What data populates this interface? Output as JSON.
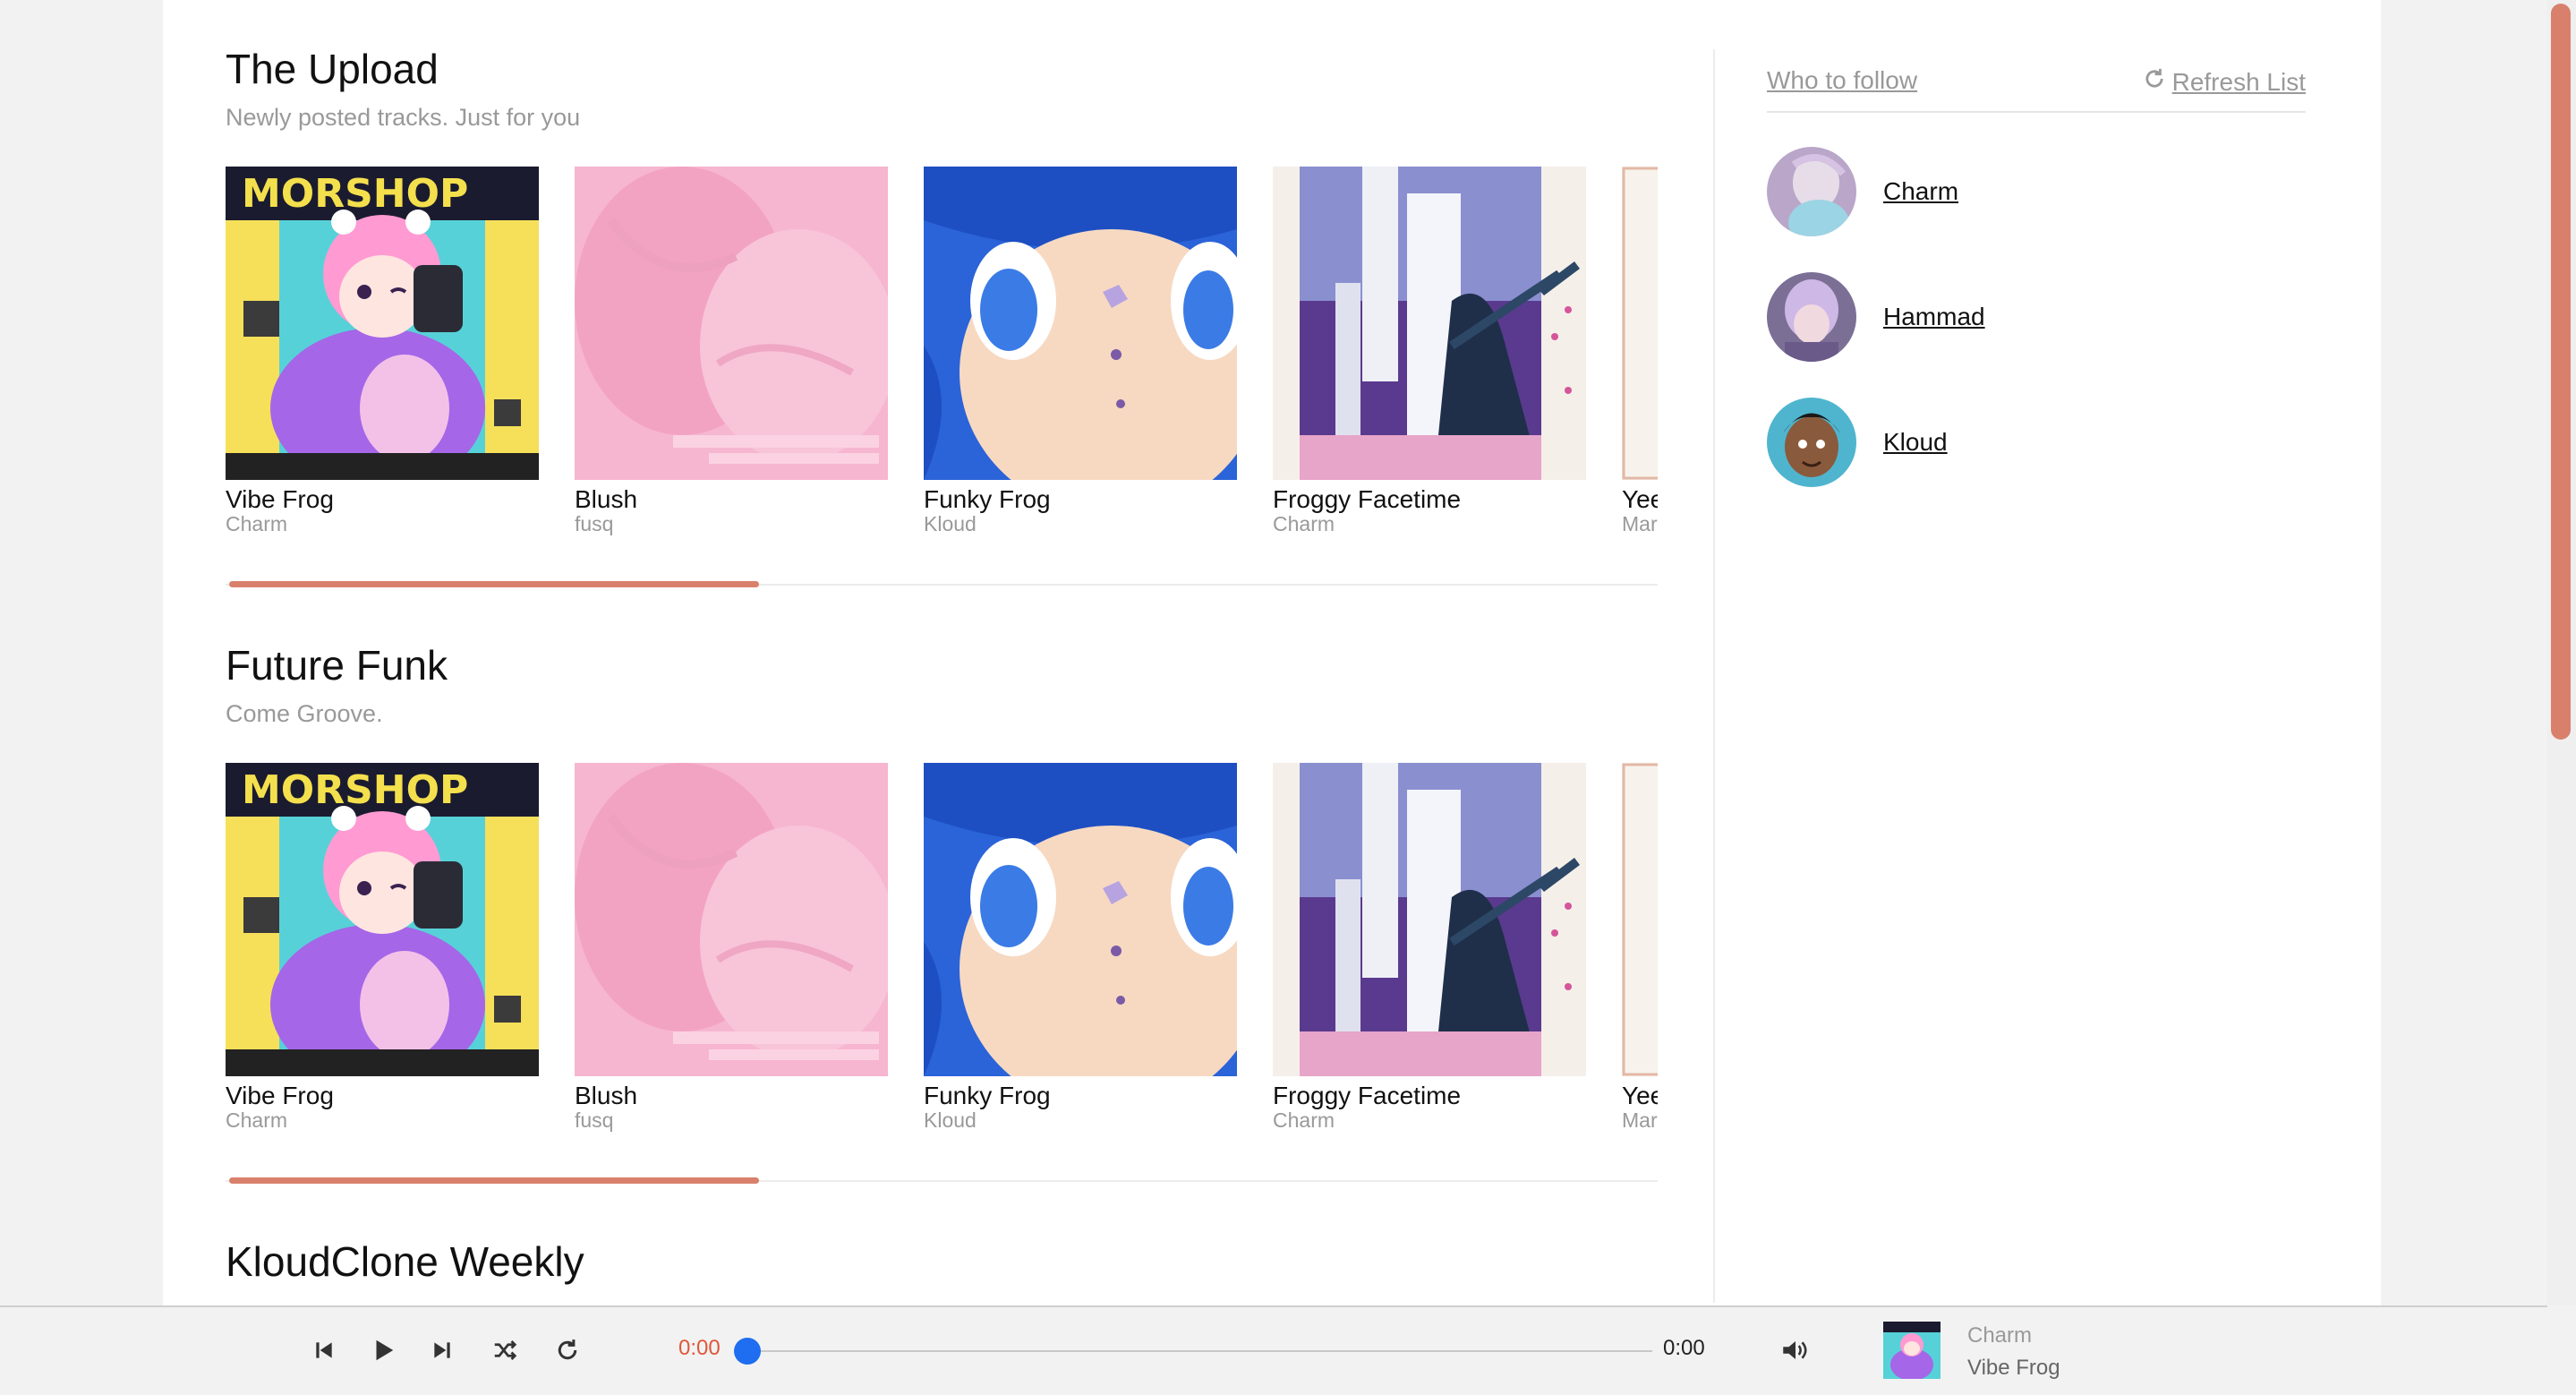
{
  "sections": [
    {
      "title": "The Upload",
      "subtitle": "Newly posted tracks. Just for you",
      "tracks": [
        {
          "title": "Vibe Frog",
          "artist": "Charm"
        },
        {
          "title": "Blush",
          "artist": "fusq"
        },
        {
          "title": "Funky Frog",
          "artist": "Kloud"
        },
        {
          "title": "Froggy Facetime",
          "artist": "Charm"
        },
        {
          "title": "Yee",
          "artist": "Mar"
        }
      ],
      "scroll_fraction": 0.37
    },
    {
      "title": "Future Funk",
      "subtitle": "Come Groove.",
      "tracks": [
        {
          "title": "Vibe Frog",
          "artist": "Charm"
        },
        {
          "title": "Blush",
          "artist": "fusq"
        },
        {
          "title": "Funky Frog",
          "artist": "Kloud"
        },
        {
          "title": "Froggy Facetime",
          "artist": "Charm"
        },
        {
          "title": "Yee",
          "artist": "Mar"
        }
      ],
      "scroll_fraction": 0.37
    },
    {
      "title": "KloudClone Weekly"
    }
  ],
  "sidebar": {
    "heading": "Who to follow",
    "refresh_label": "Refresh List",
    "users": [
      {
        "name": "Charm"
      },
      {
        "name": "Hammad"
      },
      {
        "name": "Kloud"
      }
    ]
  },
  "player": {
    "current_time": "0:00",
    "total_time": "0:00",
    "progress": 0,
    "now_playing": {
      "artist": "Charm",
      "title": "Vibe Frog"
    },
    "accent_color": "#d9806c",
    "knob_color": "#1f6df0"
  },
  "icons": [
    "skip-back-icon",
    "play-icon",
    "skip-forward-icon",
    "shuffle-icon",
    "repeat-icon",
    "volume-icon",
    "refresh-icon"
  ]
}
